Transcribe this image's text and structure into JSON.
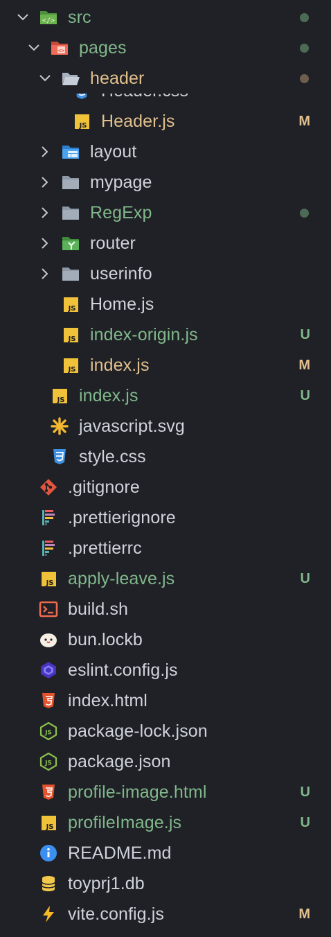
{
  "colors": {
    "background": "#1f2126",
    "text_default": "#cfd3dc",
    "added": "#81b88b",
    "modified": "#e2c08d",
    "dot_green": "#4d6a54",
    "dot_brown": "#6e5e4f"
  },
  "explorer": {
    "rows": [
      {
        "label": "src",
        "depth": 0,
        "kind": "folder-open",
        "icon": "code-folder-icon",
        "status": "",
        "dot": "green",
        "color": "added"
      },
      {
        "label": "pages",
        "depth": 1,
        "kind": "folder-open",
        "icon": "pages-folder-icon",
        "status": "",
        "dot": "green",
        "color": "added"
      },
      {
        "label": "header",
        "depth": 2,
        "kind": "folder-open",
        "icon": "folder-open-icon",
        "status": "",
        "dot": "brown",
        "color": "modified"
      },
      {
        "label": "Header.css",
        "depth": 3,
        "kind": "file",
        "icon": "css-icon",
        "status": "",
        "dot": "",
        "color": "default",
        "partial": true
      },
      {
        "label": "Header.js",
        "depth": 3,
        "kind": "file",
        "icon": "js-icon",
        "status": "M",
        "dot": "",
        "color": "modified"
      },
      {
        "label": "layout",
        "depth": 2,
        "kind": "folder-closed",
        "icon": "layout-folder-icon",
        "status": "",
        "dot": "",
        "color": "default"
      },
      {
        "label": "mypage",
        "depth": 2,
        "kind": "folder-closed",
        "icon": "folder-icon",
        "status": "",
        "dot": "",
        "color": "default"
      },
      {
        "label": "RegExp",
        "depth": 2,
        "kind": "folder-closed",
        "icon": "folder-icon",
        "status": "",
        "dot": "green",
        "color": "added"
      },
      {
        "label": "router",
        "depth": 2,
        "kind": "folder-closed",
        "icon": "router-folder-icon",
        "status": "",
        "dot": "",
        "color": "default"
      },
      {
        "label": "userinfo",
        "depth": 2,
        "kind": "folder-closed",
        "icon": "folder-icon",
        "status": "",
        "dot": "",
        "color": "default"
      },
      {
        "label": "Home.js",
        "depth": 2,
        "kind": "file",
        "icon": "js-icon",
        "status": "",
        "dot": "",
        "color": "default"
      },
      {
        "label": "index-origin.js",
        "depth": 2,
        "kind": "file",
        "icon": "js-icon",
        "status": "U",
        "dot": "",
        "color": "added"
      },
      {
        "label": "index.js",
        "depth": 2,
        "kind": "file",
        "icon": "js-icon",
        "status": "M",
        "dot": "",
        "color": "modified"
      },
      {
        "label": "index.js",
        "depth": 1,
        "kind": "file",
        "icon": "js-icon",
        "status": "U",
        "dot": "",
        "color": "added"
      },
      {
        "label": "javascript.svg",
        "depth": 1,
        "kind": "file",
        "icon": "svg-icon",
        "status": "",
        "dot": "",
        "color": "default"
      },
      {
        "label": "style.css",
        "depth": 1,
        "kind": "file",
        "icon": "css-icon",
        "status": "",
        "dot": "",
        "color": "default"
      },
      {
        "label": ".gitignore",
        "depth": 0,
        "kind": "file",
        "icon": "git-icon",
        "status": "",
        "dot": "",
        "color": "default"
      },
      {
        "label": ".prettierignore",
        "depth": 0,
        "kind": "file",
        "icon": "prettier-icon",
        "status": "",
        "dot": "",
        "color": "default"
      },
      {
        "label": ".prettierrc",
        "depth": 0,
        "kind": "file",
        "icon": "prettier-icon",
        "status": "",
        "dot": "",
        "color": "default"
      },
      {
        "label": "apply-leave.js",
        "depth": 0,
        "kind": "file",
        "icon": "js-icon",
        "status": "U",
        "dot": "",
        "color": "added"
      },
      {
        "label": "build.sh",
        "depth": 0,
        "kind": "file",
        "icon": "terminal-icon",
        "status": "",
        "dot": "",
        "color": "default"
      },
      {
        "label": "bun.lockb",
        "depth": 0,
        "kind": "file",
        "icon": "bun-icon",
        "status": "",
        "dot": "",
        "color": "default"
      },
      {
        "label": "eslint.config.js",
        "depth": 0,
        "kind": "file",
        "icon": "eslint-icon",
        "status": "",
        "dot": "",
        "color": "default"
      },
      {
        "label": "index.html",
        "depth": 0,
        "kind": "file",
        "icon": "html-icon",
        "status": "",
        "dot": "",
        "color": "default"
      },
      {
        "label": "package-lock.json",
        "depth": 0,
        "kind": "file",
        "icon": "nodejs-icon",
        "status": "",
        "dot": "",
        "color": "default"
      },
      {
        "label": "package.json",
        "depth": 0,
        "kind": "file",
        "icon": "nodejs-icon",
        "status": "",
        "dot": "",
        "color": "default"
      },
      {
        "label": "profile-image.html",
        "depth": 0,
        "kind": "file",
        "icon": "html-icon",
        "status": "U",
        "dot": "",
        "color": "added"
      },
      {
        "label": "profileImage.js",
        "depth": 0,
        "kind": "file",
        "icon": "js-icon",
        "status": "U",
        "dot": "",
        "color": "added"
      },
      {
        "label": "README.md",
        "depth": 0,
        "kind": "file",
        "icon": "info-icon",
        "status": "",
        "dot": "",
        "color": "default"
      },
      {
        "label": "toyprj1.db",
        "depth": 0,
        "kind": "file",
        "icon": "database-icon",
        "status": "",
        "dot": "",
        "color": "default"
      },
      {
        "label": "vite.config.js",
        "depth": 0,
        "kind": "file",
        "icon": "vite-icon",
        "status": "M",
        "dot": "",
        "color": "default"
      }
    ]
  }
}
